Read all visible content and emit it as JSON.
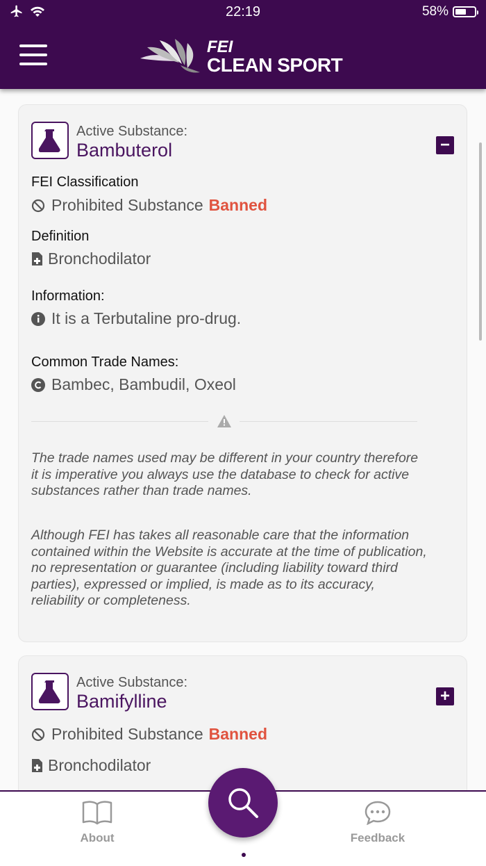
{
  "status_bar": {
    "time": "22:19",
    "battery": "58%"
  },
  "header": {
    "logo_fei": "FEI",
    "logo_clean_sport": "CLEAN SPORT"
  },
  "substances": [
    {
      "subtitle": "Active Substance:",
      "name": "Bambuterol",
      "toggle": "−",
      "classification_label": "FEI Classification",
      "classification_text": "Prohibited Substance",
      "status": "Banned",
      "definition_label": "Definition",
      "definition": "Bronchodilator",
      "information_label": "Information:",
      "information": "It is a Terbutaline pro-drug.",
      "trade_names_label": "Common Trade Names:",
      "trade_names": "Bambec, Bambudil, Oxeol",
      "disclaimer_1": "The trade names used may be different in your country therefore it is imperative you always use the database to check for active substances rather than trade names.",
      "disclaimer_2": "Although FEI has takes all reasonable care that the information contained within the Website is accurate at the time of publication, no representation or guarantee (including liability toward third parties), expressed or implied, is made as to its accuracy, reliability or completeness."
    },
    {
      "subtitle": "Active Substance:",
      "name": "Bamifylline",
      "toggle": "+",
      "classification_text": "Prohibited Substance",
      "status": "Banned",
      "definition": "Bronchodilator"
    }
  ],
  "tabbar": {
    "about": "About",
    "feedback": "Feedback"
  },
  "colors": {
    "brand": "#3d0a4f",
    "banned": "#e0533f"
  },
  "icons": {
    "menu": "hamburger-icon",
    "flask": "flask-icon",
    "prohibited": "prohibited-icon",
    "definition": "medical-document-icon",
    "info": "info-icon",
    "trade": "copyright-icon",
    "warning": "warning-icon",
    "about": "book-icon",
    "search": "search-icon",
    "feedback": "chat-icon"
  }
}
